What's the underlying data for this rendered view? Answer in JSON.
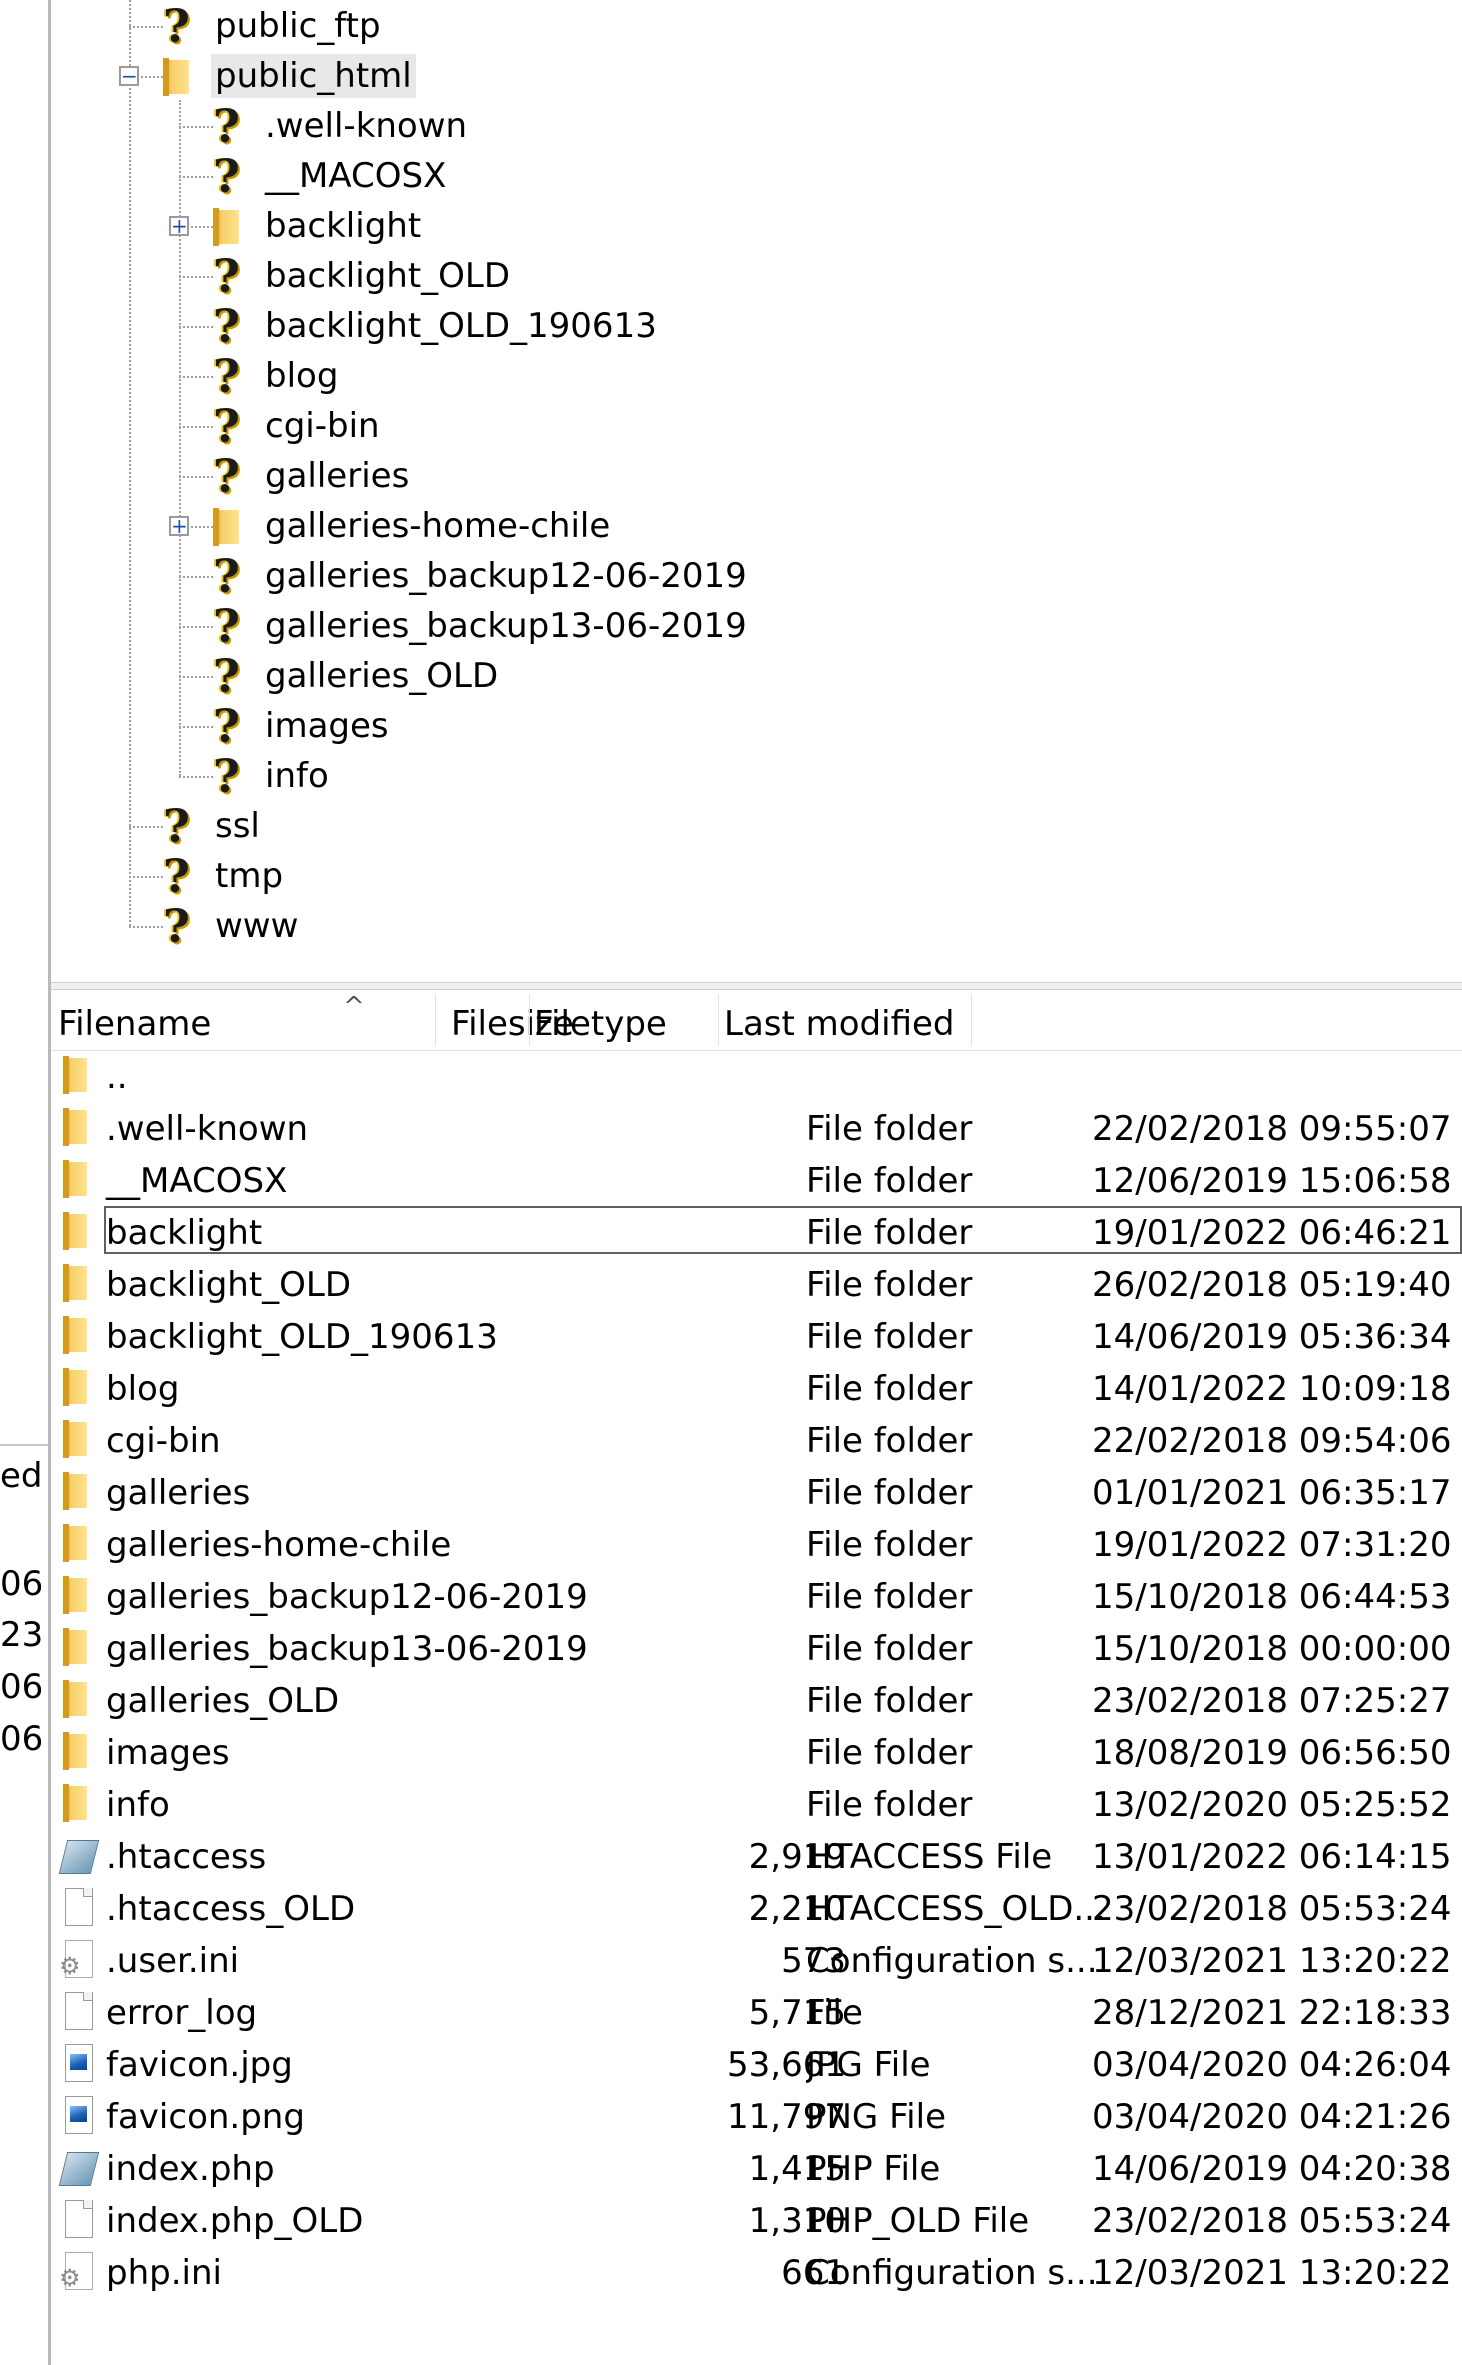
{
  "left_pane_fragments": [
    "ed",
    "06",
    "23",
    "06",
    "06"
  ],
  "tree": {
    "items": [
      {
        "label": "public_ftp",
        "icon": "question-folder-icon",
        "level": 1,
        "expander": null
      },
      {
        "label": "public_html",
        "icon": "folder-icon",
        "level": 1,
        "expander": "−",
        "selected": true
      },
      {
        "label": ".well-known",
        "icon": "question-folder-icon",
        "level": 2,
        "expander": null
      },
      {
        "label": "__MACOSX",
        "icon": "question-folder-icon",
        "level": 2,
        "expander": null
      },
      {
        "label": "backlight",
        "icon": "folder-icon",
        "level": 2,
        "expander": "+"
      },
      {
        "label": "backlight_OLD",
        "icon": "question-folder-icon",
        "level": 2,
        "expander": null
      },
      {
        "label": "backlight_OLD_190613",
        "icon": "question-folder-icon",
        "level": 2,
        "expander": null
      },
      {
        "label": "blog",
        "icon": "question-folder-icon",
        "level": 2,
        "expander": null
      },
      {
        "label": "cgi-bin",
        "icon": "question-folder-icon",
        "level": 2,
        "expander": null
      },
      {
        "label": "galleries",
        "icon": "question-folder-icon",
        "level": 2,
        "expander": null
      },
      {
        "label": "galleries-home-chile",
        "icon": "folder-icon",
        "level": 2,
        "expander": "+"
      },
      {
        "label": "galleries_backup12-06-2019",
        "icon": "question-folder-icon",
        "level": 2,
        "expander": null
      },
      {
        "label": "galleries_backup13-06-2019",
        "icon": "question-folder-icon",
        "level": 2,
        "expander": null
      },
      {
        "label": "galleries_OLD",
        "icon": "question-folder-icon",
        "level": 2,
        "expander": null
      },
      {
        "label": "images",
        "icon": "question-folder-icon",
        "level": 2,
        "expander": null
      },
      {
        "label": "info",
        "icon": "question-folder-icon",
        "level": 2,
        "expander": null
      },
      {
        "label": "ssl",
        "icon": "question-folder-icon",
        "level": 1,
        "expander": null
      },
      {
        "label": "tmp",
        "icon": "question-folder-icon",
        "level": 1,
        "expander": null
      },
      {
        "label": "www",
        "icon": "question-folder-icon",
        "level": 1,
        "expander": null
      }
    ]
  },
  "file_list": {
    "columns": {
      "filename": "Filename",
      "filesize": "Filesize",
      "filetype": "Filetype",
      "last_modified": "Last modified"
    },
    "sort_indicator": "^",
    "rows": [
      {
        "name": "..",
        "size": "",
        "type": "",
        "modified": "",
        "icon": "folder-icon"
      },
      {
        "name": ".well-known",
        "size": "",
        "type": "File folder",
        "modified": "22/02/2018 09:55:07",
        "icon": "folder-icon"
      },
      {
        "name": "__MACOSX",
        "size": "",
        "type": "File folder",
        "modified": "12/06/2019 15:06:58",
        "icon": "folder-icon"
      },
      {
        "name": "backlight",
        "size": "",
        "type": "File folder",
        "modified": "19/01/2022 06:46:21",
        "icon": "folder-icon",
        "focused": true
      },
      {
        "name": "backlight_OLD",
        "size": "",
        "type": "File folder",
        "modified": "26/02/2018 05:19:40",
        "icon": "folder-icon"
      },
      {
        "name": "backlight_OLD_190613",
        "size": "",
        "type": "File folder",
        "modified": "14/06/2019 05:36:34",
        "icon": "folder-icon"
      },
      {
        "name": "blog",
        "size": "",
        "type": "File folder",
        "modified": "14/01/2022 10:09:18",
        "icon": "folder-icon"
      },
      {
        "name": "cgi-bin",
        "size": "",
        "type": "File folder",
        "modified": "22/02/2018 09:54:06",
        "icon": "folder-icon"
      },
      {
        "name": "galleries",
        "size": "",
        "type": "File folder",
        "modified": "01/01/2021 06:35:17",
        "icon": "folder-icon"
      },
      {
        "name": "galleries-home-chile",
        "size": "",
        "type": "File folder",
        "modified": "19/01/2022 07:31:20",
        "icon": "folder-icon"
      },
      {
        "name": "galleries_backup12-06-2019",
        "size": "",
        "type": "File folder",
        "modified": "15/10/2018 06:44:53",
        "icon": "folder-icon"
      },
      {
        "name": "galleries_backup13-06-2019",
        "size": "",
        "type": "File folder",
        "modified": "15/10/2018 00:00:00",
        "icon": "folder-icon"
      },
      {
        "name": "galleries_OLD",
        "size": "",
        "type": "File folder",
        "modified": "23/02/2018 07:25:27",
        "icon": "folder-icon"
      },
      {
        "name": "images",
        "size": "",
        "type": "File folder",
        "modified": "18/08/2019 06:56:50",
        "icon": "folder-icon"
      },
      {
        "name": "info",
        "size": "",
        "type": "File folder",
        "modified": "13/02/2020 05:25:52",
        "icon": "folder-icon"
      },
      {
        "name": ".htaccess",
        "size": "2,919",
        "type": "HTACCESS File",
        "modified": "13/01/2022 06:14:15",
        "icon": "htaccess-file-icon"
      },
      {
        "name": ".htaccess_OLD",
        "size": "2,210",
        "type": "HTACCESS_OLD...",
        "modified": "23/02/2018 05:53:24",
        "icon": "blank-file-icon"
      },
      {
        "name": ".user.ini",
        "size": "573",
        "type": "Configuration s...",
        "modified": "12/03/2021 13:20:22",
        "icon": "config-file-icon"
      },
      {
        "name": "error_log",
        "size": "5,715",
        "type": "File",
        "modified": "28/12/2021 22:18:33",
        "icon": "blank-file-icon"
      },
      {
        "name": "favicon.jpg",
        "size": "53,661",
        "type": "JPG File",
        "modified": "03/04/2020 04:26:04",
        "icon": "image-file-icon"
      },
      {
        "name": "favicon.png",
        "size": "11,797",
        "type": "PNG File",
        "modified": "03/04/2020 04:21:26",
        "icon": "image-file-icon"
      },
      {
        "name": "index.php",
        "size": "1,415",
        "type": "PHP File",
        "modified": "14/06/2019 04:20:38",
        "icon": "htaccess-file-icon"
      },
      {
        "name": "index.php_OLD",
        "size": "1,310",
        "type": "PHP_OLD File",
        "modified": "23/02/2018 05:53:24",
        "icon": "blank-file-icon"
      },
      {
        "name": "php.ini",
        "size": "661",
        "type": "Configuration s...",
        "modified": "12/03/2021 13:20:22",
        "icon": "config-file-icon"
      }
    ]
  }
}
